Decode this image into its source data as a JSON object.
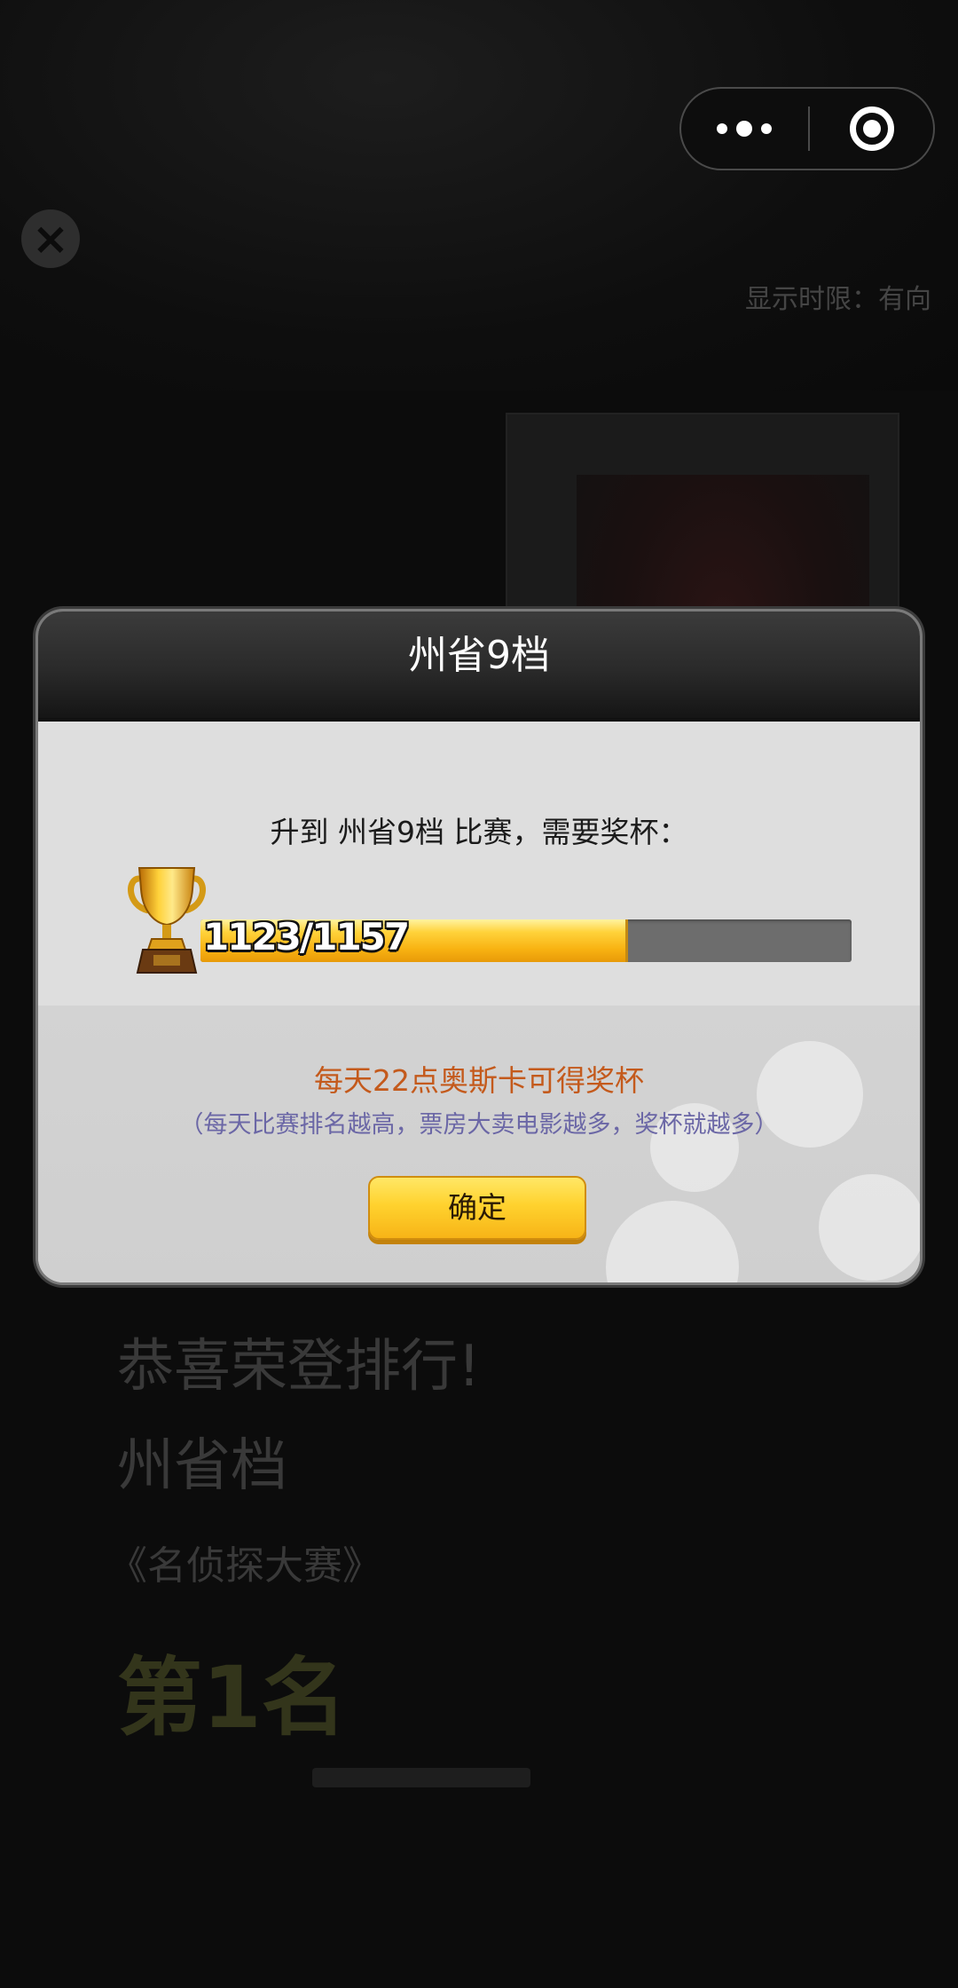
{
  "background": {
    "side_text": "显示时限：有向",
    "congrats_title": "恭喜荣登排行!",
    "level": "州省档",
    "contest": "《名侦探大赛》",
    "rank": "第1名"
  },
  "capsule": {
    "more_icon": "more-dots-icon",
    "close_icon": "target-close-icon"
  },
  "dialog": {
    "title": "州省9档",
    "requirement": "升到 州省9档 比赛，需要奖杯：",
    "progress": {
      "current": 1123,
      "total": 1157,
      "fraction": 0.652,
      "label": "1123/1157"
    },
    "tip": "每天22点奥斯卡可得奖杯",
    "sub_tip": "（每天比赛排名越高，票房大卖电影越多，奖杯就越多）",
    "confirm_label": "确定"
  },
  "colors": {
    "tip": "#c45a1c",
    "sub_tip": "#6b67a6",
    "button": "#ffd22e",
    "progress_fill": "#f8b212"
  }
}
